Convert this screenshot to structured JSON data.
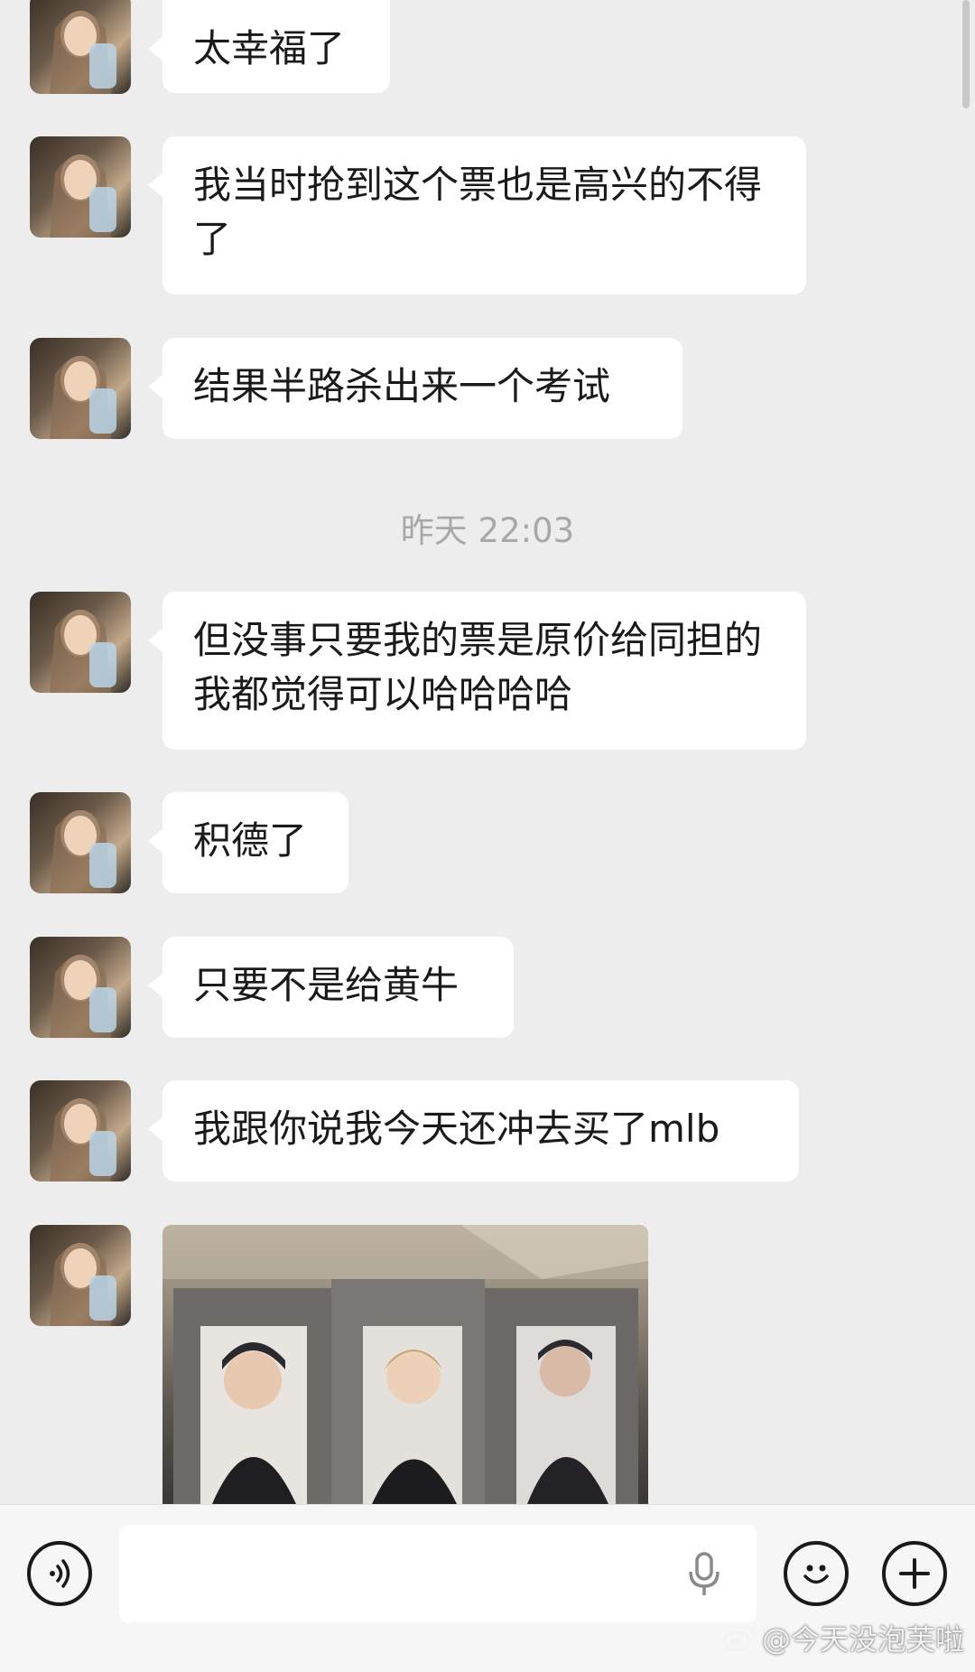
{
  "messages": [
    {
      "text": "太幸福了"
    },
    {
      "text": "我当时抢到这个票也是高兴的不得了"
    },
    {
      "text": "结果半路杀出来一个考试"
    },
    {
      "text": "但没事只要我的票是原价给同担的我都觉得可以哈哈哈哈"
    },
    {
      "text": "积德了"
    },
    {
      "text": "只要不是给黄牛"
    },
    {
      "text": "我跟你说我今天还冲去买了mlb"
    }
  ],
  "timestamp": "昨天 22:03",
  "watermark": "@今天没泡芙啦",
  "icons": {
    "voice": "voice-icon",
    "mic": "microphone-icon",
    "emoji": "emoji-icon",
    "plus": "plus-icon",
    "weibo": "weibo-icon"
  },
  "colors": {
    "background": "#ededed",
    "bubble": "#ffffff",
    "bar": "#f6f6f6"
  }
}
